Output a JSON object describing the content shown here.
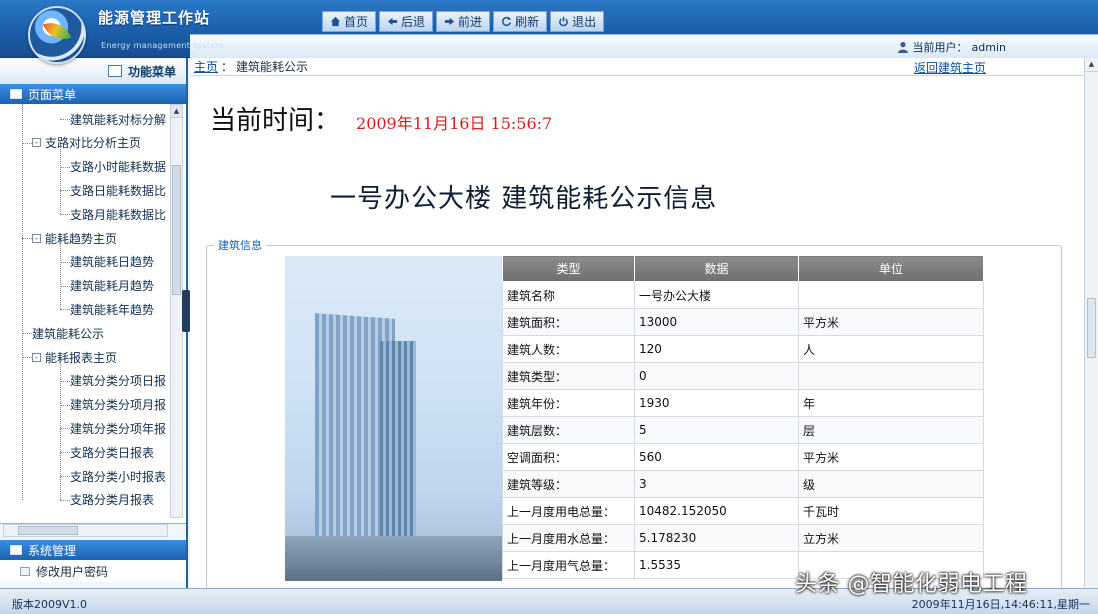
{
  "app": {
    "title": "能源管理工作站",
    "subtitle": "Energy management system"
  },
  "nav": {
    "home": "首页",
    "back": "后退",
    "forward": "前进",
    "refresh": "刷新",
    "logout": "退出"
  },
  "user": {
    "label": "当前用户：",
    "name": "admin"
  },
  "sidebar": {
    "header": "功能菜单",
    "section1": "页面菜单",
    "tree": [
      {
        "label": "建筑能耗对标分解",
        "level": 1
      },
      {
        "label": "支路对比分析主页",
        "level": 0,
        "toggle": "-"
      },
      {
        "label": "支路小时能耗数据",
        "level": 1
      },
      {
        "label": "支路日能耗数据比",
        "level": 1
      },
      {
        "label": "支路月能耗数据比",
        "level": 1
      },
      {
        "label": "能耗趋势主页",
        "level": 0,
        "toggle": "-"
      },
      {
        "label": "建筑能耗日趋势",
        "level": 1
      },
      {
        "label": "建筑能耗月趋势",
        "level": 1
      },
      {
        "label": "建筑能耗年趋势",
        "level": 1
      },
      {
        "label": "建筑能耗公示",
        "level": 0
      },
      {
        "label": "能耗报表主页",
        "level": 0,
        "toggle": "-"
      },
      {
        "label": "建筑分类分项日报",
        "level": 1
      },
      {
        "label": "建筑分类分项月报",
        "level": 1
      },
      {
        "label": "建筑分类分项年报",
        "level": 1
      },
      {
        "label": "支路分类日报表",
        "level": 1
      },
      {
        "label": "支路分类小时报表",
        "level": 1
      },
      {
        "label": "支路分类月报表",
        "level": 1
      }
    ],
    "section2": "系统管理",
    "section2_items": [
      "修改用户密码"
    ]
  },
  "breadcrumb": {
    "home": "主页",
    "separator": "：",
    "current": "建筑能耗公示",
    "back_link": "返回建筑主页"
  },
  "main": {
    "time_label": "当前时间：",
    "time_value": "2009年11月16日  15:56:7",
    "building_title": "一号办公大楼  建筑能耗公示信息",
    "fieldset_legend": "建筑信息"
  },
  "table": {
    "headers": [
      "类型",
      "数据",
      "单位"
    ],
    "rows": [
      [
        "建筑名称",
        "一号办公大楼",
        ""
      ],
      [
        "建筑面积：",
        "13000",
        "平方米"
      ],
      [
        "建筑人数：",
        "120",
        "人"
      ],
      [
        "建筑类型：",
        "0",
        ""
      ],
      [
        "建筑年份：",
        "1930",
        "年"
      ],
      [
        "建筑层数：",
        "5",
        "层"
      ],
      [
        "空调面积：",
        "560",
        "平方米"
      ],
      [
        "建筑等级：",
        "3",
        "级"
      ],
      [
        "上一月度用电总量：",
        "10482.152050",
        "千瓦时"
      ],
      [
        "上一月度用水总量：",
        "5.178230",
        "立方米"
      ],
      [
        "上一月度用气总量：",
        "1.5535",
        ""
      ]
    ]
  },
  "status": {
    "version": "版本2009V1.0",
    "clock": "2009年11月16日,14:46:11,星期一"
  },
  "watermark": "头条 @智能化弱电工程",
  "colors": {
    "header_blue": "#1b5ea9",
    "time_red": "#d81e1e",
    "table_header_gray": "#7a7a7a"
  }
}
